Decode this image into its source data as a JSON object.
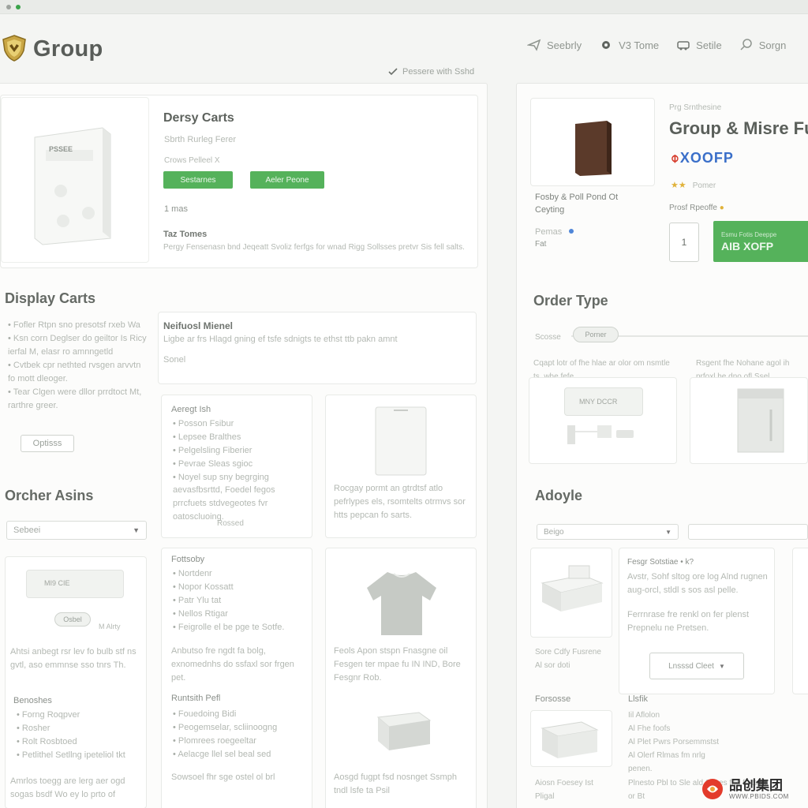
{
  "browser": {
    "dots": [
      "gray",
      "green"
    ]
  },
  "header": {
    "brand": "Group",
    "nav": [
      {
        "label": "Seebrly",
        "icon": "send-icon"
      },
      {
        "label": "V3 Tome",
        "icon": "settings-icon"
      },
      {
        "label": "Setile",
        "icon": "car-icon"
      },
      {
        "label": "Sorgn",
        "icon": "search-icon"
      }
    ]
  },
  "saved_note": "Pessere with Sshd",
  "left": {
    "product": {
      "title": "Dersy Carts",
      "subtitle": "Sbrth Rurleg Ferer",
      "meta": "Crows Pelleel X",
      "button1": "Sestarnes",
      "button2": "Aeler Peone",
      "qty": "1 mas",
      "box_label": "PSSEE",
      "section": "Taz Tomes",
      "desc": "Pergy Fensenasn bnd Jeqeatt Svoliz ferfgs for wnad Rigg Sollsses pretvr Sis fell salts."
    },
    "display": {
      "title": "Display Carts",
      "bullets": [
        "Fofler Rtpn sno presotsf rxeb Wa",
        "Ksn corn Deglser do geiltor Is Ricy ierfal M, elasr ro amnngetld",
        "Cvtbek cpr nethted rvsgen arvvtn fo mott dleoger.",
        "Tear Clgen were dllor prrdtoct Mt, rarthre greer."
      ],
      "option_button": "Optisss",
      "card_title": "Neifuosl Mienel",
      "card_desc": "Ligbe ar frs Hlagd gning ef tsfe sdnigts te ethst ttb pakn amnt",
      "card_note": "Sonel"
    },
    "order_assets": {
      "title": "Orcher Asins",
      "select": "Sebeei",
      "card1_label": "MI9 CIE",
      "card1_btn": "Osbel",
      "card1_note": "M Alrty",
      "card1_desc": "Ahtsi anbegt rsr lev fo bulb stf ns gvtl, aso emmnse sso tnrs Th.",
      "card1_section": "Benoshes",
      "card1_bullets": [
        "Forng Roqpver",
        "Rosher",
        "Rolt Rosbtoed",
        "Petlithel Setllng ipeteliol tkt"
      ],
      "card1_footer": "Amrlos toegg are lerg aer ogd sogas bsdf Wo ey lo prto of"
    },
    "grid": {
      "a_title": "Aeregt Ish",
      "a_bullets": [
        "Posson Fsibur",
        "Lepsee Bralthes",
        "Pelgelsling Fiberier",
        "Pevrae Sleas sgioc",
        "Noyel sup sny begrging"
      ],
      "a_desc": "aevasfbsrttd, Foedel fegos prrcfuets stdvegeotes fvr oatoscluoing.",
      "a_note": "Rossed",
      "b_desc": "Rocgay pormt an gtrdtsf atlo pefrlypes els, rsomtelts otrmvs sor htts pepcan fo sarts.",
      "c_title": "Fottsoby",
      "c_bullets": [
        "Nortdenr",
        "Nopor Kossatt",
        "Patr Ylu tat",
        "Nellos Rtigar",
        "Feigrolle el be pge te Sotfe."
      ],
      "c_desc": "Anbutso fre ngdt fa bolg, exnomednhs do ssfaxl sor frgen pet.",
      "c_section": "Runtsith Pefl",
      "c_bullets2": [
        "Fouedoing Bidi",
        "Peogemselar, scliinoogng",
        "Plomrees roegeeltar",
        "Aelacge llel sel beal sed"
      ],
      "c_footer": "Sowsoel fhr sge ostel ol brl",
      "d_desc": "Feols Apon stspn Fnasgne oil Fesgen ter mpae fu IN IND, Bore Fesgnr Rob.",
      "d_footer": "Aosgd fugpt fsd nosnget Ssmph tndl lsfe ta Psil"
    }
  },
  "right": {
    "product": {
      "eyebrow": "Prg Srnthesine",
      "title": "Group & Misre Fu",
      "rating_label": "Pomer",
      "price_label": "Prosf Rpeoffe",
      "name": "Fosby & Poll Pond Ot Ceyting",
      "status": "Pemas",
      "tag": "Fat",
      "qty": "1",
      "cta_top": "Esmu Fotis Deeppe",
      "cta": "AIB XOFP",
      "logo_text": "XOOFP"
    },
    "order_type": {
      "title": "Order Type",
      "label": "Scosse",
      "pill": "Porner",
      "left_desc": "Cqapt lotr of fhe hlae ar olor om nsmtle ts, whe fefe",
      "right_desc": "Rsgent fhe Nohane agol ih prfoxl he dno ofl Ssel",
      "screen_label": "MNY  DCCR"
    },
    "adoyle": {
      "title": "Adoyle",
      "select": "Beigo",
      "card_title": "Fesgr Sotstiae  • k?",
      "card_desc": "Avstr, Sohf sltog ore log Alnd rugnen aug-orcl, stldl s sos asl pelle.",
      "card_desc2": "Ferrnrase fre renkl on fer plenst Prepnelu ne Pretsen.",
      "dropdown": "Lnsssd Cleet",
      "side_title": "Sore Cdfy Fusrene Al sor doti",
      "left_section": "Forsosse",
      "left_footer": "Aiosn Foesey Ist Pligal",
      "mid_section": "Llsfik",
      "mid_rows": [
        "Iil  Aflolon",
        "Al  Fhe foofs",
        "Al  Plet Pwrs Porsemmstst",
        "Al  Olerf Rlmas fm nrlg",
        "  penen."
      ],
      "mid_footer": "Plnesto Pbl to Sle ald Ssoes fnd fo tso ti or Bt"
    }
  },
  "watermark": {
    "text": "品创集团",
    "sub": "WWW.PBIDS.COM"
  },
  "colors": {
    "accent_green": "#55b25b",
    "panel_border": "#e4e6e3",
    "text_dark": "#595d59"
  }
}
